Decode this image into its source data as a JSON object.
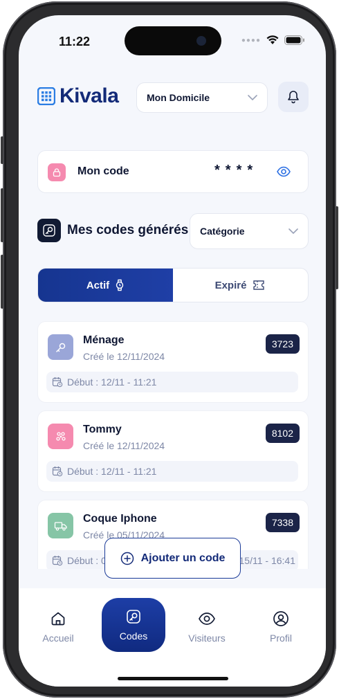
{
  "status_bar": {
    "time": "11:22"
  },
  "header": {
    "logo_text": "Kivala",
    "home_select": "Mon Domicile"
  },
  "my_code": {
    "label": "Mon code",
    "mask": "****"
  },
  "section": {
    "title": "Mes codes générés",
    "category_select": "Catégorie"
  },
  "tabs": [
    {
      "label": "Actif",
      "active": true
    },
    {
      "label": "Expiré",
      "active": false
    }
  ],
  "codes": [
    {
      "name": "Ménage",
      "created": "Créé le 12/11/2024",
      "code": "3723",
      "start": "Début : 12/11 - 11:21",
      "end": "",
      "color": "#9aa6d8"
    },
    {
      "name": "Tommy",
      "created": "Créé le 12/11/2024",
      "code": "8102",
      "start": "Début : 12/11 - 11:21",
      "end": "",
      "color": "#f58aaf"
    },
    {
      "name": "Coque Iphone",
      "created": "Créé le 05/11/2024",
      "code": "7338",
      "start": "Début : 0",
      "end": "15/11 - 16:41",
      "color": "#86c5a6"
    }
  ],
  "add_button": "Ajouter un code",
  "bottom_nav": [
    {
      "label": "Accueil",
      "icon": "home-icon",
      "active": false
    },
    {
      "label": "Codes",
      "icon": "key-icon",
      "active": true
    },
    {
      "label": "Visiteurs",
      "icon": "eye-icon",
      "active": false
    },
    {
      "label": "Profil",
      "icon": "user-icon",
      "active": false
    }
  ],
  "colors": {
    "primary": "#1a3a97",
    "dark": "#1b2448",
    "background": "#f5f7fc"
  }
}
